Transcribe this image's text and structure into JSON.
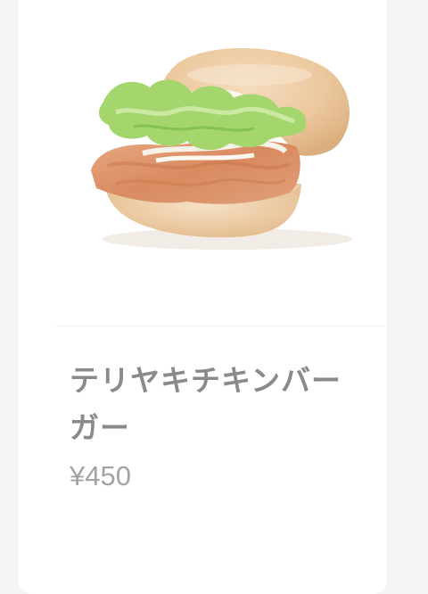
{
  "product": {
    "image_icon": "teriyaki-chicken-burger-photo",
    "name": "テリヤキチキンバーガー",
    "price": "¥450"
  },
  "colors": {
    "background": "#f5f5f5",
    "card": "#ffffff",
    "name_text": "#8a8a8a",
    "price_text": "#a3a3a3"
  }
}
